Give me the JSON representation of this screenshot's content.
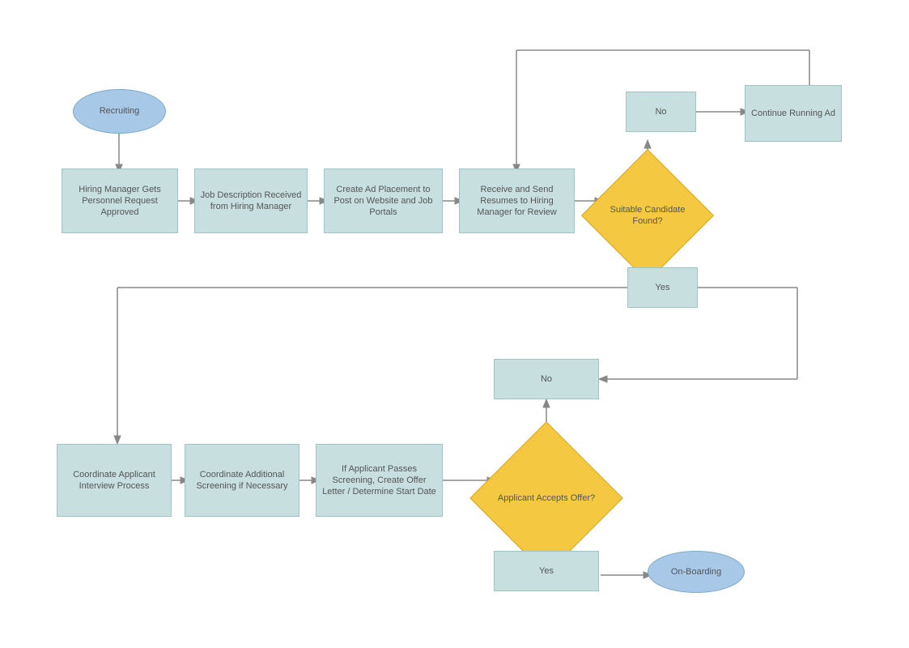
{
  "nodes": {
    "recruiting": {
      "label": "Recruiting"
    },
    "hiring_manager": {
      "label": "Hiring Manager Gets Personnel Request Approved"
    },
    "job_description": {
      "label": "Job Description Received from Hiring Manager"
    },
    "create_ad": {
      "label": "Create Ad Placement to Post on Website and Job Portals"
    },
    "receive_send": {
      "label": "Receive and Send Resumes to Hiring Manager for Review"
    },
    "suitable_candidate": {
      "label": "Suitable Candidate Found?"
    },
    "no_box": {
      "label": "No"
    },
    "continue_running": {
      "label": "Continue Running Ad"
    },
    "yes_box": {
      "label": "Yes"
    },
    "no_box2": {
      "label": "No"
    },
    "coordinate_interview": {
      "label": "Coordinate Applicant Interview Process"
    },
    "coordinate_screening": {
      "label": "Coordinate Additional Screening if Necessary"
    },
    "if_applicant": {
      "label": "If Applicant Passes Screening, Create Offer Letter / Determine Start Date"
    },
    "applicant_accepts": {
      "label": "Applicant Accepts Offer?"
    },
    "yes_box2": {
      "label": "Yes"
    },
    "onboarding": {
      "label": "On-Boarding"
    }
  }
}
